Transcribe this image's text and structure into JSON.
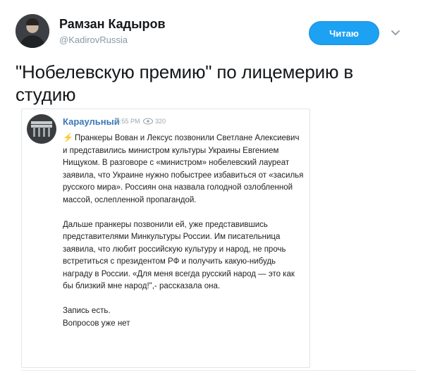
{
  "tweet": {
    "user_name": "Рамзан Кадыров",
    "handle": "@KadirovRussia",
    "follow_label": "Читаю",
    "text": "\"Нобелевскую премию\" по лицемерию в студию"
  },
  "embedded_post": {
    "channel_name": "Караульный",
    "time": "6:55 PM",
    "views": "320",
    "paragraph1": "Пранкеры Вован и Лексус позвонили Светлане Алексиевич и представились министром культуры Украины Евгением Нищуком. В разговоре с «министром» нобелевский лауреат заявила, что Украине нужно побыстрее избавиться от «засилья русского мира». Россиян она назвала голодной озлобленной массой, ослепленной пропагандой.",
    "paragraph2": "Дальше пранкеры позвонили ей, уже представившись представителями Минкультуры России. Им писательница заявила, что любит российскую культуру и народ, не прочь встретиться с президентом РФ и получить какую-нибудь награду в России. «Для меня всегда русский народ — это как бы близкий мне народ!\",- рассказала она.",
    "line_a": "Запись есть.",
    "line_b": "Вопросов уже нет"
  },
  "icons": [
    "avatar",
    "chevron-down-icon",
    "eye-icon",
    "lightning-icon"
  ],
  "colors": {
    "accent": "#1da1f2",
    "channel_name": "#3a79b8",
    "lightning": "#f0b020"
  }
}
